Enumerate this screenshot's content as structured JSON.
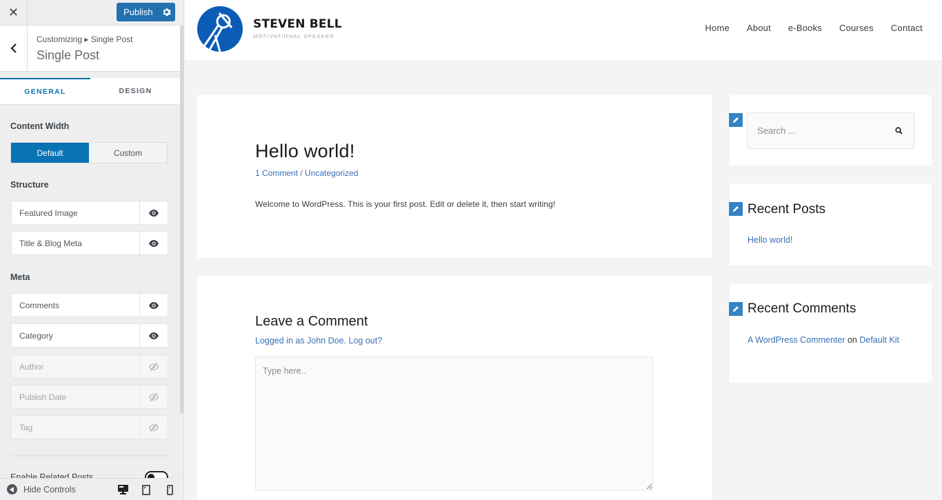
{
  "customizer": {
    "close_icon": "close-icon",
    "publish_label": "Publish",
    "publish_settings_icon": "gear-icon",
    "breadcrumb": "Customizing ▸ Single Post",
    "section_title": "Single Post",
    "tabs": [
      {
        "label": "GENERAL",
        "active": true
      },
      {
        "label": "DESIGN",
        "active": false
      }
    ],
    "content_width": {
      "label": "Content Width",
      "options": [
        {
          "label": "Default",
          "active": true
        },
        {
          "label": "Custom",
          "active": false
        }
      ]
    },
    "structure": {
      "label": "Structure",
      "items": [
        {
          "label": "Featured Image",
          "visible": true
        },
        {
          "label": "Title & Blog Meta",
          "visible": true
        }
      ]
    },
    "meta": {
      "label": "Meta",
      "items": [
        {
          "label": "Comments",
          "visible": true
        },
        {
          "label": "Category",
          "visible": true
        },
        {
          "label": "Author",
          "visible": false
        },
        {
          "label": "Publish Date",
          "visible": false
        },
        {
          "label": "Tag",
          "visible": false
        }
      ]
    },
    "related_posts": {
      "label": "Enable Related Posts",
      "enabled": false
    },
    "footer": {
      "hide_controls_label": "Hide Controls",
      "devices": [
        "desktop",
        "tablet",
        "mobile"
      ],
      "active_device": "desktop"
    },
    "accent_color": "#0a73b4"
  },
  "site": {
    "brand_name": "STEVEN BELL",
    "brand_tagline": "MOTIVATIONAL SPEAKER",
    "brand_color": "#0b5cb5",
    "nav": [
      "Home",
      "About",
      "e-Books",
      "Courses",
      "Contact"
    ],
    "post": {
      "title": "Hello world!",
      "meta_comments": "1 Comment",
      "meta_separator": " / ",
      "meta_category": "Uncategorized",
      "body": "Welcome to WordPress. This is your first post. Edit or delete it, then start writing!"
    },
    "comments": {
      "title": "Leave a Comment",
      "logged_in_link": "Logged in as John Doe.",
      "logout_link": "Log out?",
      "placeholder": "Type here.."
    },
    "sidebar": {
      "search_placeholder": "Search ...",
      "recent_posts_title": "Recent Posts",
      "recent_posts": [
        "Hello world!"
      ],
      "recent_comments_title": "Recent Comments",
      "recent_comment": {
        "author": "A WordPress Commenter",
        "on": " on ",
        "post": "Default Kit"
      }
    },
    "link_color": "#3a6fb5"
  }
}
